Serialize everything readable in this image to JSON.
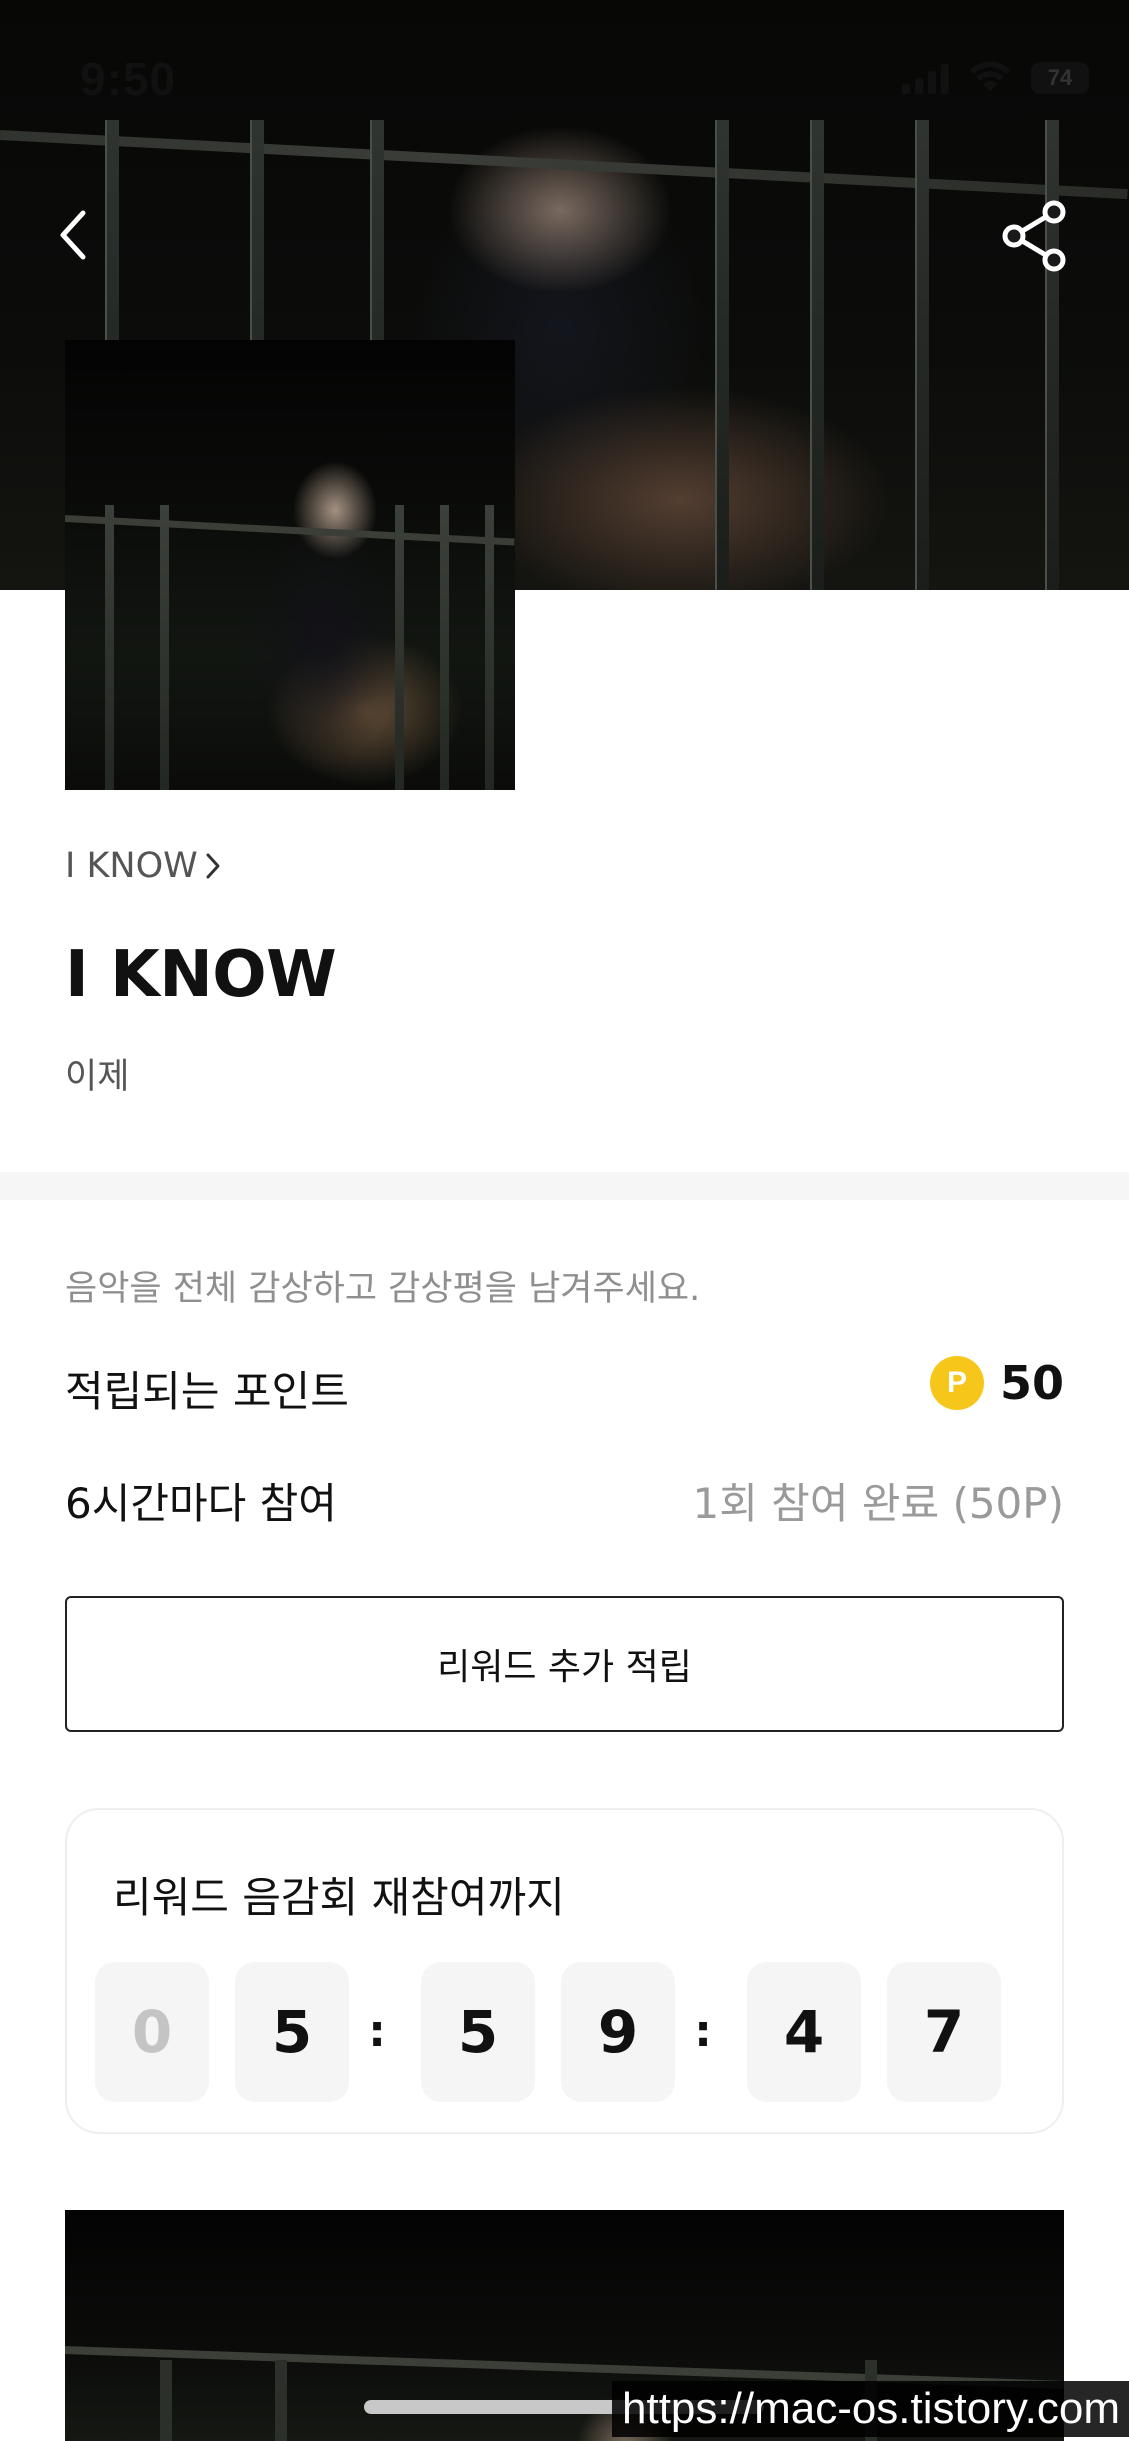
{
  "status_bar": {
    "time": "9:50",
    "battery": "74"
  },
  "nav": {
    "back_icon": "chevron-left-icon",
    "share_icon": "share-icon"
  },
  "track": {
    "breadcrumb": "I KNOW",
    "title": "I KNOW",
    "artist": "이제"
  },
  "reward": {
    "instruction": "음악을 전체 감상하고 감상평을 남겨주세요.",
    "points_label": "적립되는 포인트",
    "points_badge": "P",
    "points_value": "50",
    "cycle_label": "6시간마다 참여",
    "cycle_status": "1회 참여 완료 (50P)",
    "button_label": "리워드 추가 적립"
  },
  "countdown": {
    "title": "리워드 음감회 재참여까지",
    "digits": [
      "0",
      "5",
      "5",
      "9",
      "4",
      "7"
    ],
    "separator": ":"
  },
  "watermark": "https://mac-os.tistory.com",
  "colors": {
    "point_badge": "#f7c61b",
    "divider": "#f6f6f6",
    "digit_bg": "#f5f5f5"
  }
}
